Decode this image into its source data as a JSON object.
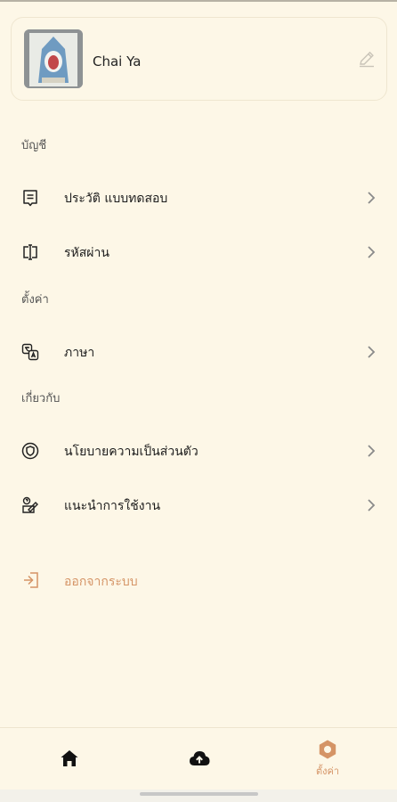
{
  "profile": {
    "name": "Chai Ya"
  },
  "sections": {
    "account": "บัญชี",
    "settings": "ตั้งค่า",
    "about": "เกี่ยวกับ"
  },
  "menu": {
    "test_history": "ประวัติ แบบทดสอบ",
    "password": "รหัสผ่าน",
    "language": "ภาษา",
    "privacy_policy": "นโยบายความเป็นส่วนตัว",
    "usage_guide": "แนะนำการใช้งาน",
    "logout": "ออกจากระบบ"
  },
  "bottom_nav": {
    "items": [
      {
        "icon": "home-icon"
      },
      {
        "icon": "cloud-upload-icon"
      },
      {
        "icon": "settings-icon",
        "label": "ตั้งค่า",
        "active": true
      }
    ]
  },
  "colors": {
    "background": "#fdf7e7",
    "accent": "#d59466",
    "text": "#1f1f1f"
  }
}
